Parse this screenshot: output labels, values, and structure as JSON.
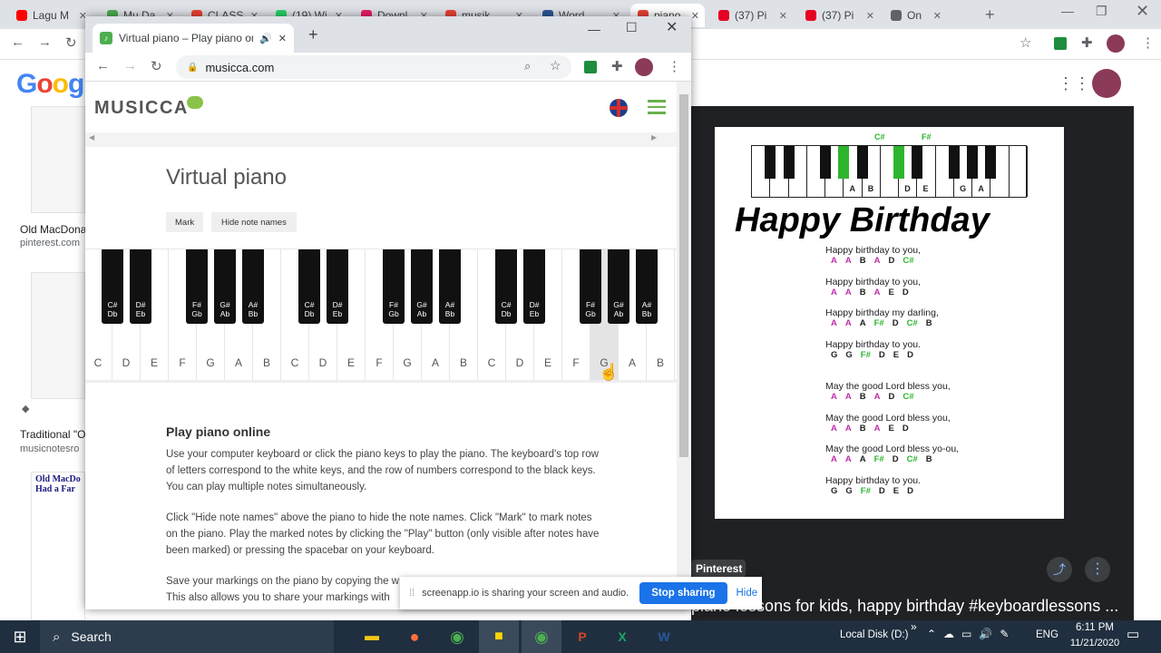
{
  "bg_tabs": [
    {
      "label": "Lagu M",
      "icon": "youtube-icon",
      "color": "#ff0000"
    },
    {
      "label": "Mu Da",
      "icon": "doc-icon",
      "color": "#4caf50"
    },
    {
      "label": "CLASS",
      "icon": "google-icon",
      "color": "#ea4335"
    },
    {
      "label": "(19) Wi",
      "icon": "whatsapp-icon",
      "color": "#25d366"
    },
    {
      "label": "Downl",
      "icon": "download-icon",
      "color": "#e91e63"
    },
    {
      "label": "musik",
      "icon": "google-icon",
      "color": "#ea4335"
    },
    {
      "label": "Word",
      "icon": "word-icon",
      "color": "#2b579a"
    },
    {
      "label": "piano",
      "icon": "google-icon",
      "color": "#ea4335"
    },
    {
      "label": "(37) Pi",
      "icon": "pinterest-icon",
      "color": "#e60023"
    },
    {
      "label": "(37) Pi",
      "icon": "pinterest-icon",
      "color": "#e60023"
    },
    {
      "label": "On",
      "icon": "cast-icon",
      "color": "#5f6368"
    }
  ],
  "google_logo": "Google",
  "results": [
    {
      "title": "Old MacDona",
      "source": "pinterest.com"
    },
    {
      "title": "Traditional \"O",
      "source": "musicnotesro"
    }
  ],
  "thumb_sheet_title": "Old MacDo\nHad a Far",
  "fg_tab": {
    "title": "Virtual piano – Play piano on"
  },
  "address": "musicca.com",
  "site": {
    "logo": "MUSICCA",
    "page_title": "Virtual piano",
    "mark_button": "Mark",
    "hide_names_button": "Hide note names",
    "section_title": "Play piano online",
    "para1": "Use your computer keyboard or click the piano keys to play the piano. The keyboard's top row of letters correspond to the white keys, and the row of numbers correspond to the black keys. You can play multiple notes simultaneously.",
    "para2": "Click \"Hide note names\" above the piano to hide the note names. Click \"Mark\" to mark notes on the piano. Play the marked notes by clicking the \"Play\" button (only visible after notes have been marked) or pressing the spacebar on your keyboard.",
    "para3_line1": "Save your markings on the piano by copying the w",
    "para3_line2": "This also allows you to share your markings with"
  },
  "white_keys": [
    "C",
    "D",
    "E",
    "F",
    "G",
    "A",
    "B",
    "C",
    "D",
    "E",
    "F",
    "G",
    "A",
    "B",
    "C",
    "D",
    "E",
    "F",
    "G",
    "A",
    "B"
  ],
  "pressed_white_key": "G",
  "black_keys": [
    [
      "C#",
      "Db"
    ],
    [
      "D#",
      "Eb"
    ],
    [
      "F#",
      "Gb"
    ],
    [
      "G#",
      "Ab"
    ],
    [
      "A#",
      "Bb"
    ],
    [
      "C#",
      "Db"
    ],
    [
      "D#",
      "Eb"
    ],
    [
      "F#",
      "Gb"
    ],
    [
      "G#",
      "Ab"
    ],
    [
      "A#",
      "Bb"
    ],
    [
      "C#",
      "Db"
    ],
    [
      "D#",
      "Eb"
    ],
    [
      "F#",
      "Gb"
    ],
    [
      "G#",
      "Ab"
    ],
    [
      "A#",
      "Bb"
    ]
  ],
  "share_bar": {
    "message": "screenapp.io is sharing your screen and audio.",
    "stop": "Stop sharing",
    "hide": "Hide"
  },
  "lesson": {
    "top_labels": [
      "C#",
      "F#"
    ],
    "key_labels": [
      "A",
      "B",
      "D",
      "E",
      "G",
      "A"
    ],
    "title": "Happy Birthday",
    "verses": [
      {
        "lyric": "Happy birthday to you,",
        "notes": [
          [
            "A",
            "#c02fa8"
          ],
          [
            "A",
            "#c02fa8"
          ],
          [
            "B",
            "#222"
          ],
          [
            "A",
            "#c02fa8"
          ],
          [
            "D",
            "#222"
          ],
          [
            "C#",
            "#2db52d"
          ]
        ]
      },
      {
        "lyric": "Happy birthday to you,",
        "notes": [
          [
            "A",
            "#c02fa8"
          ],
          [
            "A",
            "#c02fa8"
          ],
          [
            "B",
            "#222"
          ],
          [
            "A",
            "#c02fa8"
          ],
          [
            "E",
            "#222"
          ],
          [
            "D",
            "#222"
          ]
        ]
      },
      {
        "lyric": "Happy birthday my darling,",
        "notes": [
          [
            "A",
            "#c02fa8"
          ],
          [
            "A",
            "#c02fa8"
          ],
          [
            "A",
            "#222"
          ],
          [
            "F#",
            "#2db52d"
          ],
          [
            "D",
            "#222"
          ],
          [
            "C#",
            "#2db52d"
          ],
          [
            "B",
            "#222"
          ]
        ]
      },
      {
        "lyric": "Happy birthday to you.",
        "notes": [
          [
            "G",
            "#222"
          ],
          [
            "G",
            "#222"
          ],
          [
            "F#",
            "#2db52d"
          ],
          [
            "D",
            "#222"
          ],
          [
            "E",
            "#222"
          ],
          [
            "D",
            "#222"
          ]
        ]
      },
      {
        "lyric": "May the good Lord bless you,",
        "notes": [
          [
            "A",
            "#c02fa8"
          ],
          [
            "A",
            "#c02fa8"
          ],
          [
            "B",
            "#222"
          ],
          [
            "A",
            "#c02fa8"
          ],
          [
            "D",
            "#222"
          ],
          [
            "C#",
            "#2db52d"
          ]
        ]
      },
      {
        "lyric": "May the good Lord bless you,",
        "notes": [
          [
            "A",
            "#c02fa8"
          ],
          [
            "A",
            "#c02fa8"
          ],
          [
            "B",
            "#222"
          ],
          [
            "A",
            "#c02fa8"
          ],
          [
            "E",
            "#222"
          ],
          [
            "D",
            "#222"
          ]
        ]
      },
      {
        "lyric": "May the good Lord bless yo-ou,",
        "notes": [
          [
            "A",
            "#c02fa8"
          ],
          [
            "A",
            "#c02fa8"
          ],
          [
            "A",
            "#222"
          ],
          [
            "F#",
            "#2db52d"
          ],
          [
            "D",
            "#222"
          ],
          [
            "C#",
            "#2db52d"
          ],
          [
            "B",
            "#222"
          ]
        ]
      },
      {
        "lyric": "Happy birthday to you.",
        "notes": [
          [
            "G",
            "#222"
          ],
          [
            "G",
            "#222"
          ],
          [
            "F#",
            "#2db52d"
          ],
          [
            "D",
            "#222"
          ],
          [
            "E",
            "#222"
          ],
          [
            "D",
            "#222"
          ]
        ]
      }
    ]
  },
  "panel": {
    "source": "Pinterest",
    "caption": "piano lessons for kids, happy birthday #keyboardlessons ..."
  },
  "taskbar": {
    "search": "Search",
    "drive": "Local Disk (D:)",
    "lang": "ENG",
    "time": "6:11 PM",
    "date": "11/21/2020"
  }
}
